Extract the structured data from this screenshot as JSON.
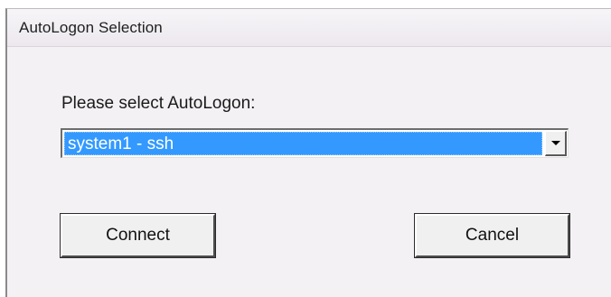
{
  "window": {
    "title": "AutoLogon Selection"
  },
  "dialog": {
    "prompt": "Please select AutoLogon:",
    "selection": {
      "value": "system1 - ssh",
      "highlight_color": "#3399ff"
    },
    "buttons": {
      "connect_label": "Connect",
      "cancel_label": "Cancel"
    }
  },
  "icons": {
    "dropdown": "chevron-down-icon"
  }
}
